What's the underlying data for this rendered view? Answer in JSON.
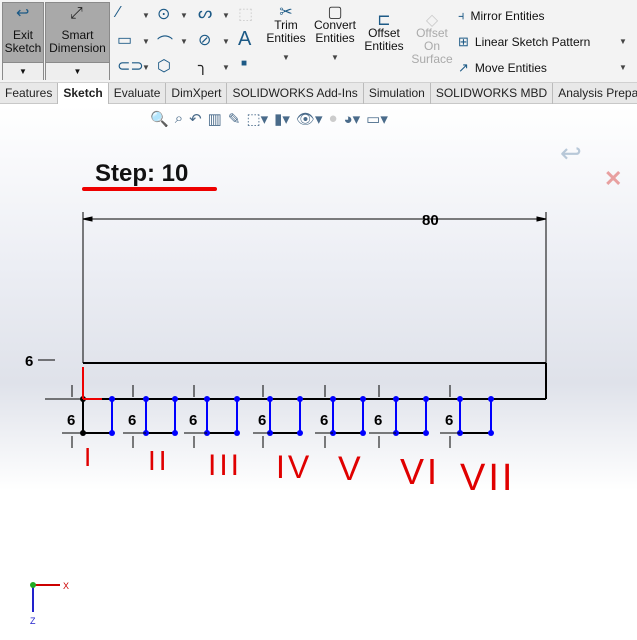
{
  "ribbon": {
    "exit_sketch": "Exit Sketch",
    "smart_dimension": "Smart Dimension",
    "trim": "Trim Entities",
    "convert": "Convert Entities",
    "offset": "Offset Entities",
    "offset_surface": "Offset On Surface",
    "mirror": "Mirror Entities",
    "linear_pattern": "Linear Sketch Pattern",
    "move": "Move Entities"
  },
  "tabs": [
    "Features",
    "Sketch",
    "Evaluate",
    "DimXpert",
    "SOLIDWORKS Add-Ins",
    "Simulation",
    "SOLIDWORKS MBD",
    "Analysis Prepa"
  ],
  "active_tab": "Sketch",
  "step_label": "Step: 10",
  "dimensions": {
    "width": "80",
    "height_top": "6",
    "square": "6"
  },
  "square_labels": [
    "6",
    "6",
    "6",
    "6",
    "6",
    "6",
    "6"
  ],
  "annotations": [
    "I",
    "II",
    "III",
    "IV",
    "V",
    "VI",
    "VII"
  ],
  "triad": {
    "x": "X",
    "z": "Z"
  },
  "colors": {
    "sketch_fixed": "#000000",
    "sketch_under_defined": "#0000ff",
    "annotation": "#e00000"
  }
}
